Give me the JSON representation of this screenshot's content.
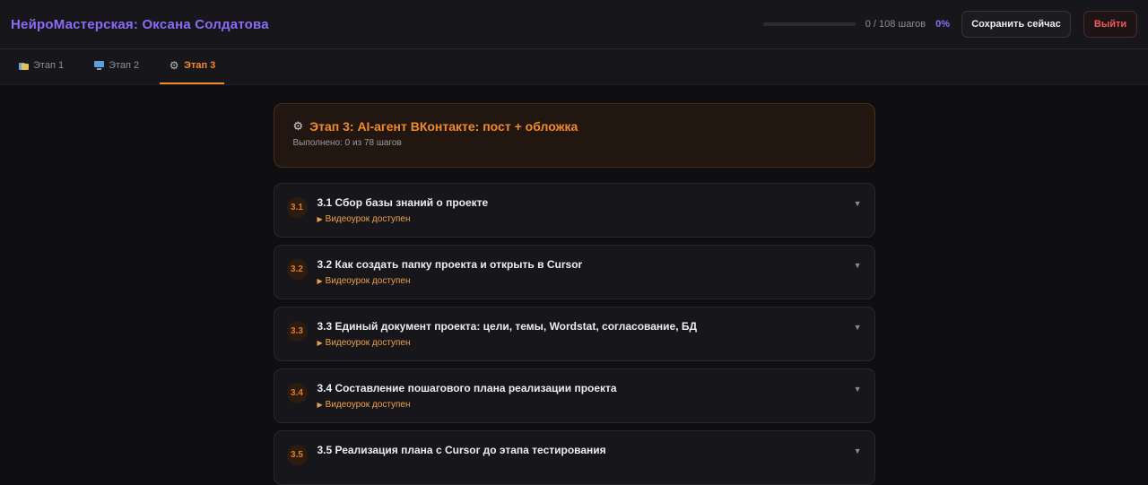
{
  "header": {
    "title": "НейроМастерская: Оксана Солдатова",
    "progress_text": "0 / 108 шагов",
    "progress_percent_label": "0%",
    "progress_fraction": 0,
    "save_label": "Сохранить сейчас",
    "exit_label": "Выйти"
  },
  "tabs": [
    {
      "label": "Этап 1",
      "icon": "folder-icon"
    },
    {
      "label": "Этап 2",
      "icon": "monitor-icon"
    },
    {
      "label": "Этап 3",
      "icon": "gear-icon",
      "active": true
    }
  ],
  "stage": {
    "title": "Этап 3: AI-агент ВКонтакте: пост + обложка",
    "subtitle": "Выполнено: 0 из 78 шагов"
  },
  "lessons": [
    {
      "number": "3.1",
      "title": "3.1 Сбор базы знаний о проекте",
      "video": "Видеоурок доступен"
    },
    {
      "number": "3.2",
      "title": "3.2 Как создать папку проекта и открыть в Cursor",
      "video": "Видеоурок доступен"
    },
    {
      "number": "3.3",
      "title": "3.3 Единый документ проекта: цели, темы, Wordstat, согласование, БД",
      "video": "Видеоурок доступен"
    },
    {
      "number": "3.4",
      "title": "3.4 Составление пошагового плана реализации проекта",
      "video": "Видеоурок доступен"
    },
    {
      "number": "3.5",
      "title": "3.5 Реализация плана с Cursor до этапа тестирования",
      "video": ""
    }
  ],
  "colors": {
    "brand": "#8b6cf6",
    "accent": "#f08a2c",
    "danger": "#ef5a5a"
  }
}
